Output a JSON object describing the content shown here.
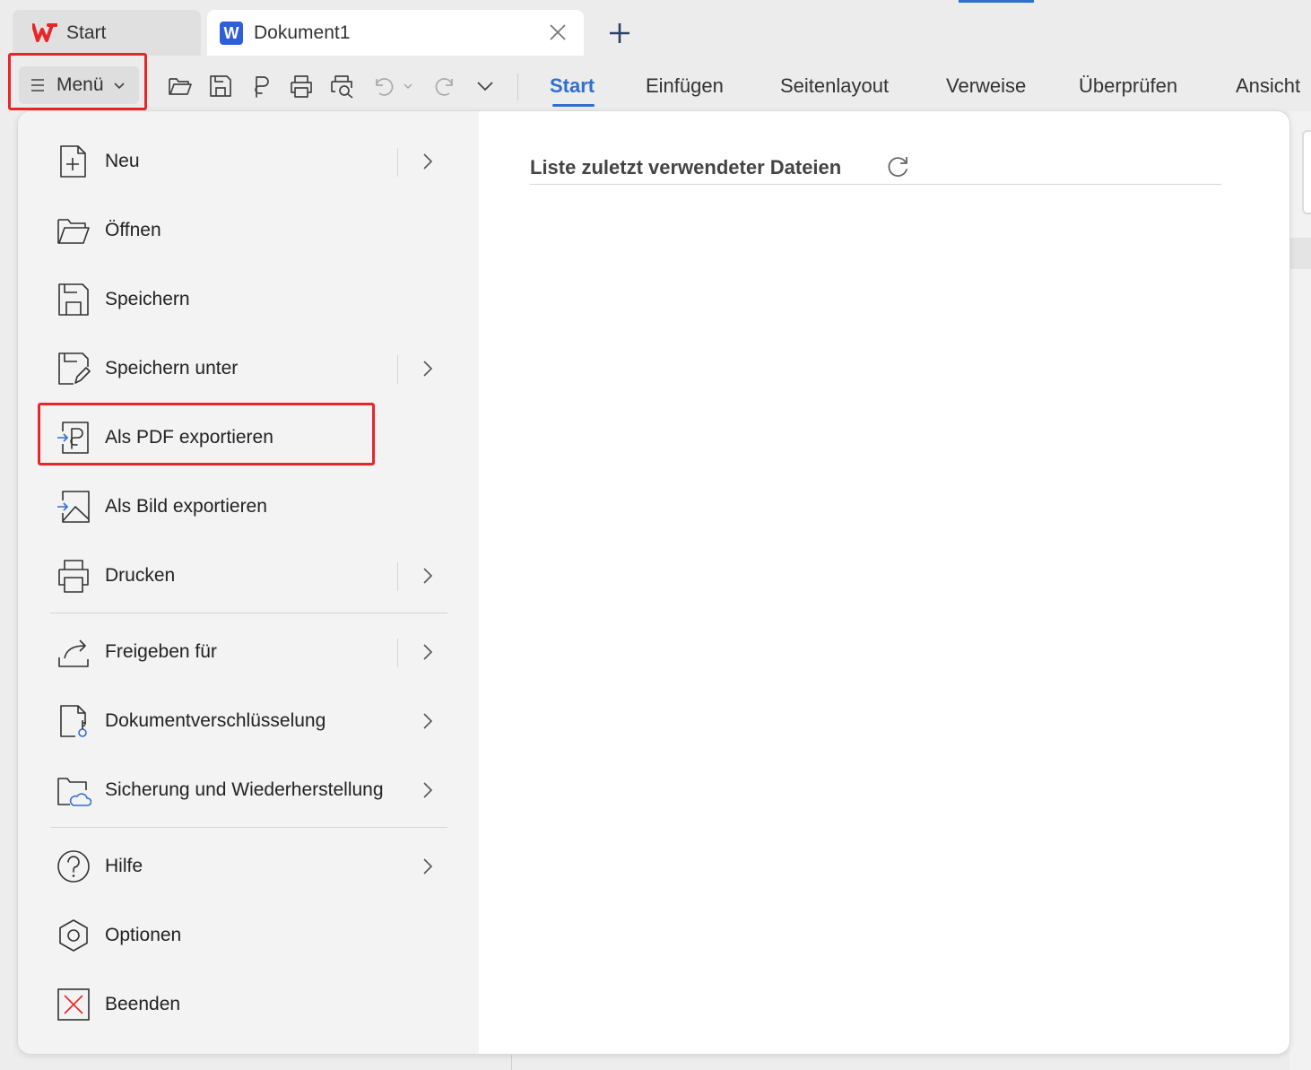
{
  "tabs": {
    "start_label": "Start",
    "doc_logo": "W",
    "doc_label": "Dokument1"
  },
  "toolbar": {
    "menu_label": "Menü",
    "icons": [
      "open-folder-icon",
      "save-icon",
      "pdf-export-icon",
      "print-icon",
      "print-preview-icon",
      "undo-icon",
      "redo-icon",
      "more-chevron-icon"
    ]
  },
  "ribbon": {
    "tabs": [
      "Start",
      "Einfügen",
      "Seitenlayout",
      "Verweise",
      "Überprüfen",
      "Ansicht"
    ],
    "active": "Start"
  },
  "menu": {
    "items": [
      {
        "label": "Neu",
        "icon": "new-document-icon",
        "submenu": true
      },
      {
        "label": "Öffnen",
        "icon": "open-folder-icon",
        "submenu": false
      },
      {
        "label": "Speichern",
        "icon": "save-icon",
        "submenu": false
      },
      {
        "label": "Speichern unter",
        "icon": "save-as-icon",
        "submenu": true
      },
      {
        "label": "Als PDF exportieren",
        "icon": "export-pdf-icon",
        "submenu": false,
        "highlighted": true
      },
      {
        "label": "Als Bild exportieren",
        "icon": "export-image-icon",
        "submenu": false
      },
      {
        "label": "Drucken",
        "icon": "print-icon",
        "submenu": true
      },
      {
        "label": "Freigeben für",
        "icon": "share-icon",
        "submenu": true
      },
      {
        "label": "Dokumentverschlüsselung",
        "icon": "document-lock-icon",
        "submenu": true
      },
      {
        "label": "Sicherung und Wiederherstellung",
        "icon": "backup-cloud-icon",
        "submenu": true
      },
      {
        "label": "Hilfe",
        "icon": "help-icon",
        "submenu": true
      },
      {
        "label": "Optionen",
        "icon": "options-gear-icon",
        "submenu": false
      },
      {
        "label": "Beenden",
        "icon": "exit-icon",
        "submenu": false
      }
    ]
  },
  "recent": {
    "title": "Liste zuletzt verwendeter Dateien"
  },
  "colors": {
    "accent": "#2f6fd1",
    "highlight": "#e8262a",
    "wps_red": "#e8262a",
    "word_blue": "#2f5fd8"
  }
}
